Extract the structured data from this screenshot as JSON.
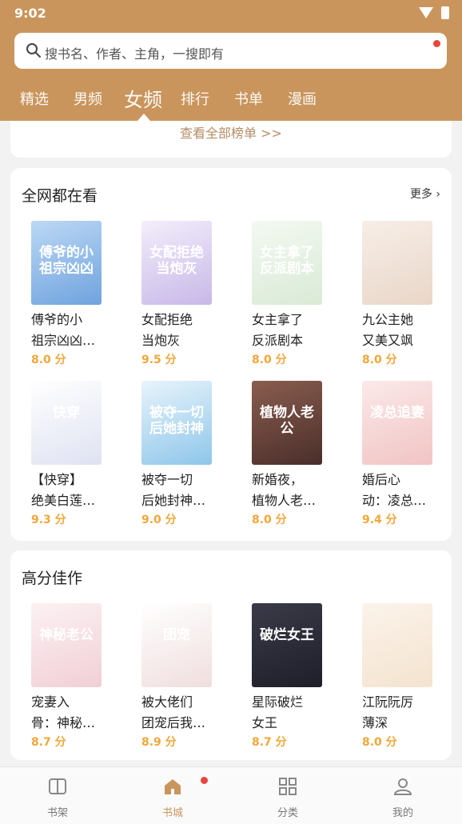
{
  "status": {
    "time": "9:02"
  },
  "search": {
    "placeholder": "搜书名、作者、主角，一搜即有"
  },
  "tabs": [
    "精选",
    "男频",
    "女频",
    "排行",
    "书单",
    "漫画"
  ],
  "view_all": "查看全部榜单 >>",
  "sections": [
    {
      "title": "全网都在看",
      "more": "更多",
      "books": [
        {
          "title": "傅爷的小\n祖宗凶凶…",
          "score": "8.0 分",
          "cover_text": "傅爷的小祖宗凶凶",
          "colors": [
            "#6fa3de",
            "#bcd8f5"
          ]
        },
        {
          "title": "女配拒绝\n当炮灰",
          "score": "9.5 分",
          "cover_text": "女配拒绝当炮灰",
          "colors": [
            "#c8b8e8",
            "#f3eefb"
          ]
        },
        {
          "title": "女主拿了\n反派剧本",
          "score": "8.0 分",
          "cover_text": "女主拿了反派剧本",
          "colors": [
            "#d9ead6",
            "#f4f9f2"
          ]
        },
        {
          "title": "九公主她\n又美又飒",
          "score": "8.0 分",
          "cover_text": "",
          "colors": [
            "#e9d6c8",
            "#f7eee7"
          ]
        },
        {
          "title": "【快穿】\n绝美白莲…",
          "score": "9.3 分",
          "cover_text": "快穿",
          "colors": [
            "#dfe2f2",
            "#ffffff"
          ]
        },
        {
          "title": "被夺一切\n后她封神…",
          "score": "9.0 分",
          "cover_text": "被夺一切后她封神",
          "colors": [
            "#8ec6ea",
            "#e8f4fb"
          ]
        },
        {
          "title": "新婚夜，\n植物人老…",
          "score": "8.0 分",
          "cover_text": "植物人老公",
          "colors": [
            "#4a2e2a",
            "#8a5d4f"
          ]
        },
        {
          "title": "婚后心\n动：凌总…",
          "score": "9.4 分",
          "cover_text": "凌总追妻",
          "colors": [
            "#f1c4c4",
            "#fbe9e9"
          ]
        }
      ]
    },
    {
      "title": "高分佳作",
      "books": [
        {
          "title": "宠妻入\n骨：神秘…",
          "score": "8.7 分",
          "cover_text": "神秘老公",
          "colors": [
            "#f1cfd6",
            "#fcf1f3"
          ]
        },
        {
          "title": "被大佬们\n团宠后我…",
          "score": "8.9 分",
          "cover_text": "团宠",
          "colors": [
            "#f0dede",
            "#ffffff"
          ]
        },
        {
          "title": "星际破烂\n女王",
          "score": "8.7 分",
          "cover_text": "破烂女王",
          "colors": [
            "#1e1f2a",
            "#3b3a48"
          ]
        },
        {
          "title": "江阮阮厉\n薄深",
          "score": "8.0 分",
          "cover_text": "",
          "colors": [
            "#f4e3cf",
            "#fbf3ea"
          ]
        }
      ]
    }
  ],
  "nav": [
    {
      "label": "书架",
      "icon": "bookshelf-icon"
    },
    {
      "label": "书城",
      "icon": "home-icon"
    },
    {
      "label": "分类",
      "icon": "grid-icon"
    },
    {
      "label": "我的",
      "icon": "user-icon"
    }
  ]
}
